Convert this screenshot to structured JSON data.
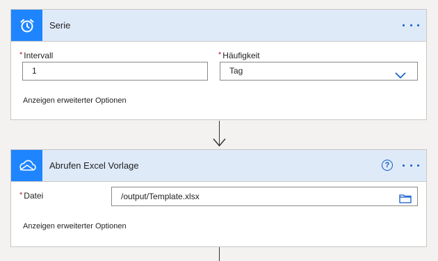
{
  "card1": {
    "title": "Serie",
    "interval_label": "Intervall",
    "interval_value": "1",
    "frequency_label": "Häufigkeit",
    "frequency_value": "Tag",
    "advanced_link": "Anzeigen erweiterter Optionen",
    "icon": "alarm-clock-icon"
  },
  "card2": {
    "title": "Abrufen Excel Vorlage",
    "file_label": "Datei",
    "file_value": "/output/Template.xlsx",
    "advanced_link": "Anzeigen erweiterter Optionen",
    "icon": "onedrive-cloud-icon"
  },
  "required_marker": "*",
  "help_glyph": "?",
  "colors": {
    "accent": "#1f85ff",
    "header_bg": "#dfeaf9",
    "link": "#0b59c8",
    "required": "#a4262c"
  }
}
